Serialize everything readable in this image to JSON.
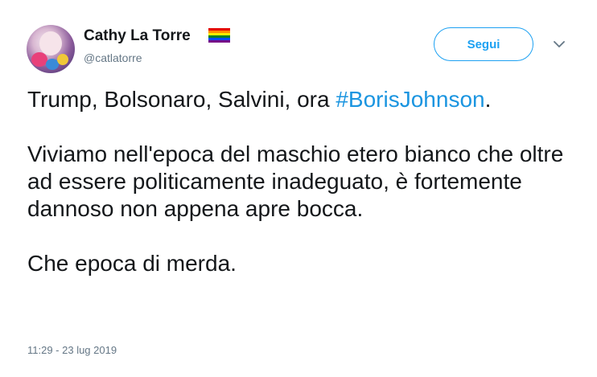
{
  "author": {
    "display_name": "Cathy La Torre",
    "handle": "@catlatorre",
    "badge_icon": "rainbow-flag-icon",
    "flag_colors": [
      "#e40303",
      "#ff8c00",
      "#ffed00",
      "#008026",
      "#004dff",
      "#750787"
    ]
  },
  "actions": {
    "follow_label": "Segui",
    "menu_icon": "chevron-down-icon"
  },
  "tweet": {
    "line1_prefix": "Trump, Bolsonaro, Salvini, ora ",
    "hashtag": "#BorisJohnson",
    "line1_suffix": ".",
    "paragraph2": "Viviamo nell'epoca del maschio etero bianco che oltre ad essere politicamente inadeguato, è fortemente dannoso non appena apre bocca.",
    "paragraph3": "Che epoca di merda.",
    "timestamp": "11:29 - 23 lug 2019"
  },
  "colors": {
    "accent": "#1da1f2",
    "hashtag": "#1b95e0",
    "muted": "#657786",
    "text": "#14171a"
  }
}
